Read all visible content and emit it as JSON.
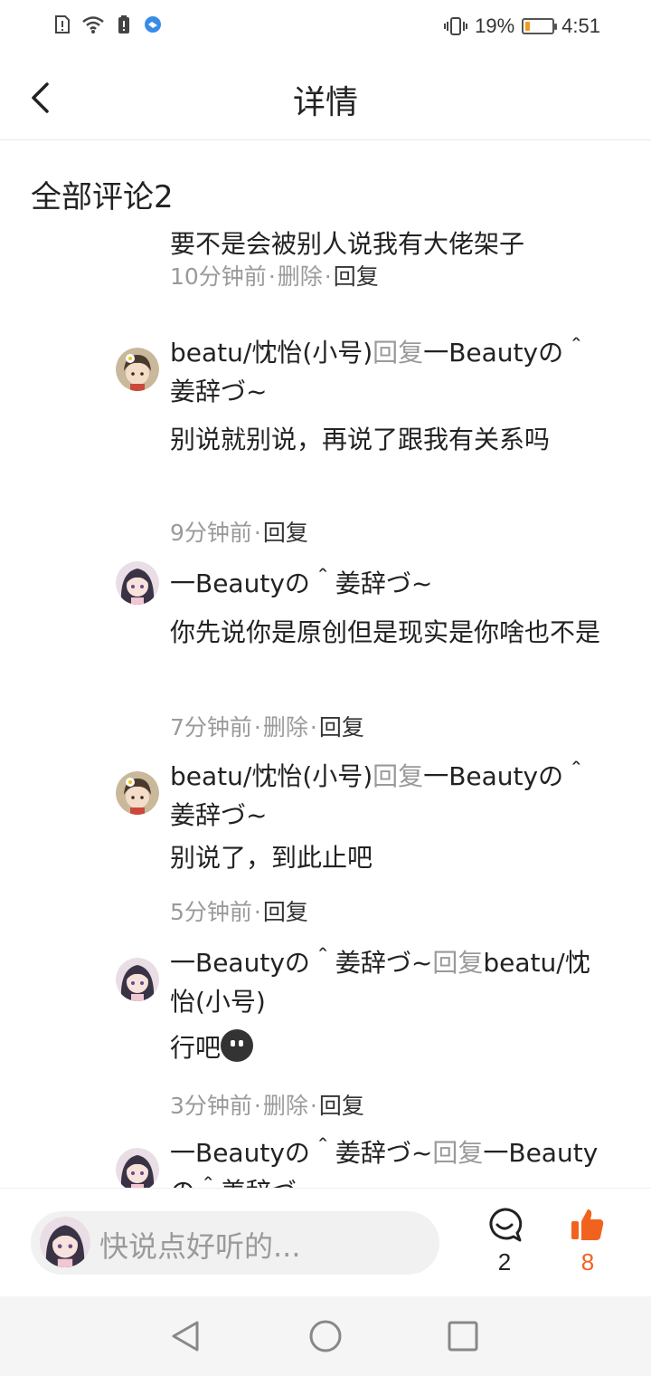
{
  "status_bar": {
    "battery_pct": "19%",
    "time": "4:51",
    "battery_level": 0.19,
    "battery_color": "#f39b1d"
  },
  "header": {
    "title": "详情"
  },
  "comments_section": {
    "title": "全部评论2",
    "items": [
      {
        "text": "要不是会被别人说我有大佬架子",
        "meta": {
          "time": "10分钟前",
          "delete": "删除",
          "reply": "回复"
        }
      },
      {
        "author": "beatu/忱怡(小号)",
        "reply_word": "回复",
        "target": "一Beautyの＾姜辞づ~",
        "text": "别说就别说，再说了跟我有关系吗",
        "meta": {
          "time": "9分钟前",
          "reply": "回复"
        }
      },
      {
        "author": "一Beautyの＾姜辞づ~",
        "text": "你先说你是原创但是现实是你啥也不是",
        "meta": {
          "time": "7分钟前",
          "delete": "删除",
          "reply": "回复"
        }
      },
      {
        "author": "beatu/忱怡(小号)",
        "reply_word": "回复",
        "target": "一Beautyの＾姜辞づ~",
        "text": "别说了，到此止吧",
        "meta": {
          "time": "5分钟前",
          "reply": "回复"
        }
      },
      {
        "author": "一Beautyの＾姜辞づ~",
        "reply_word": "回复",
        "target": "beatu/忱怡(小号)",
        "text": "行吧",
        "meta": {
          "time": "3分钟前",
          "delete": "删除",
          "reply": "回复"
        }
      },
      {
        "author": "一Beautyの＾姜辞づ~",
        "reply_word": "回复",
        "target": "一Beautyの＾姜辞づ"
      }
    ]
  },
  "bottom_bar": {
    "input_placeholder": "快说点好听的...",
    "comment_count": "2",
    "like_count": "8",
    "like_color": "#f2621f"
  },
  "nav_bar": {
    "buttons": [
      "back",
      "home",
      "recents"
    ]
  }
}
